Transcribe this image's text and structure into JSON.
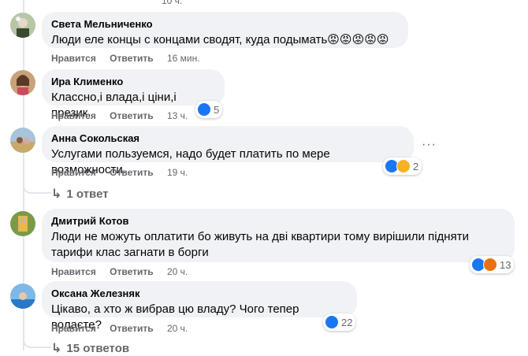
{
  "comments": [
    {
      "author": "Света Мельниченко",
      "text": "Люди еле концы с концами сводят, куда подымать😡😡😡😡😡",
      "like_label": "Нравится",
      "reply_label": "Ответить",
      "time": "16 мин.",
      "top_time": "10 ч."
    },
    {
      "author": "Ира Клименко",
      "text": "Классно,і влада,і ціни,і презик.",
      "like_label": "Нравится",
      "reply_label": "Ответить",
      "time": "13 ч.",
      "reaction_count": "5",
      "reactions": [
        "like-icon"
      ]
    },
    {
      "author": "Анна Сокольская",
      "text": "Услугами пользуемся, надо будет платить по мере возможности.",
      "like_label": "Нравится",
      "reply_label": "Ответить",
      "time": "19 ч.",
      "reaction_count": "2",
      "reactions": [
        "like-icon",
        "haha-icon"
      ],
      "replies_label": "1 ответ",
      "more_label": "···"
    },
    {
      "author": "Дмитрий Котов",
      "text": "Люди не можуть оплатити бо живуть на дві квартири тому вирішили підняти тарифи клас загнати в борги",
      "like_label": "Нравится",
      "reply_label": "Ответить",
      "time": "20 ч.",
      "reaction_count": "13",
      "reactions": [
        "like-icon",
        "angry-icon"
      ]
    },
    {
      "author": "Оксана Железняк",
      "text": "Цікаво, а хто ж вибрав цю владу? Чого тепер волаєте?",
      "like_label": "Нравится",
      "reply_label": "Ответить",
      "time": "20 ч.",
      "reaction_count": "22",
      "reactions": [
        "like-icon"
      ],
      "replies_label": "15 ответов"
    }
  ],
  "colors": {
    "bubble": "#f0f2f5",
    "like": "#1877f2",
    "angry": "#e9710f",
    "haha": "#f7b125",
    "meta": "#65676b"
  }
}
